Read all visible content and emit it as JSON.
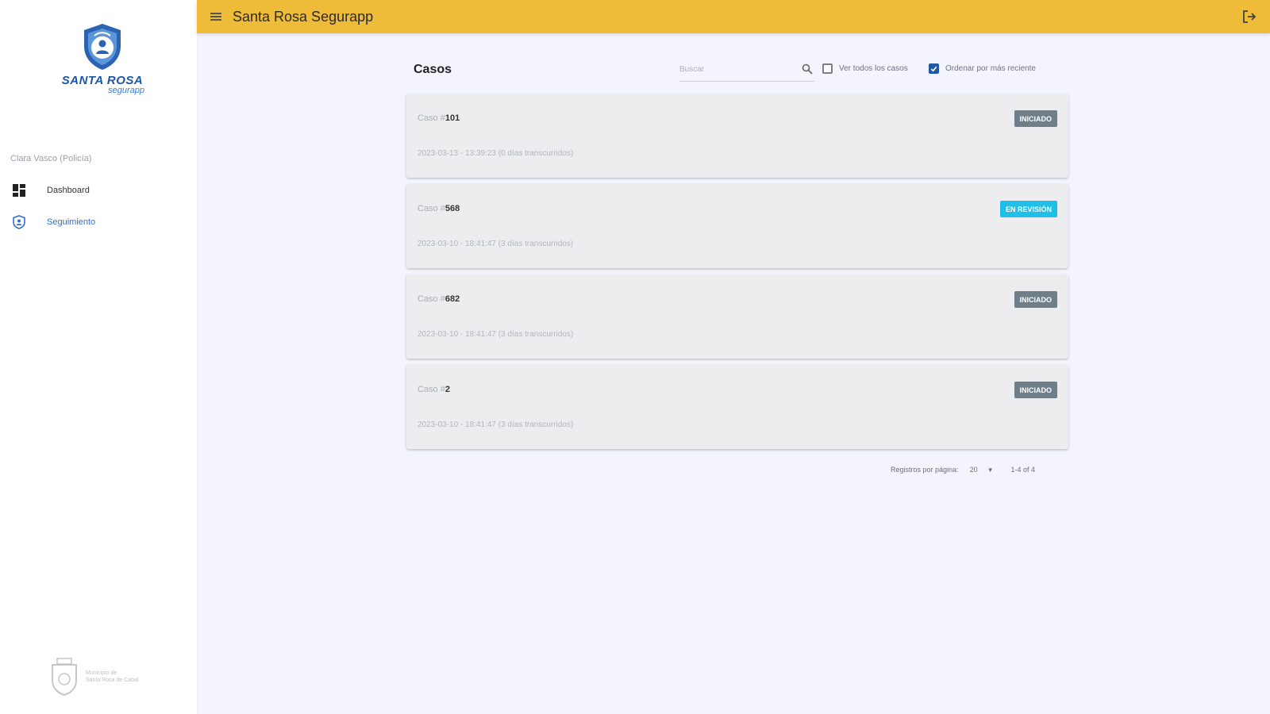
{
  "app": {
    "title": "Santa Rosa Segurapp"
  },
  "logo": {
    "name": "SANTA ROSA",
    "sub": "segurapp"
  },
  "sidebar": {
    "user": "Clara Vasco (Policía)",
    "items": [
      {
        "label": "Dashboard",
        "icon": "dashboard-icon"
      },
      {
        "label": "Seguimiento",
        "icon": "shield-user-icon",
        "active": true
      }
    ],
    "footer": {
      "line1": "Municipio de",
      "line2": "Santa Rosa de Cabal"
    }
  },
  "cases": {
    "title": "Casos",
    "search_placeholder": "Buscar",
    "filter_all_label": "Ver todos los casos",
    "filter_all_checked": false,
    "sort_recent_label": "Ordenar por más reciente",
    "sort_recent_checked": true,
    "case_prefix": "Caso #",
    "items": [
      {
        "number": "101",
        "status": "INICIADO",
        "status_color": "#6e7f8a",
        "date": "2023-03-13 - 13:39:23 (0 días transcurridos)"
      },
      {
        "number": "568",
        "status": "EN REVISIÓN",
        "status_color": "#1ec0e8",
        "date": "2023-03-10 - 18:41:47 (3 días transcurridos)"
      },
      {
        "number": "682",
        "status": "INICIADO",
        "status_color": "#6e7f8a",
        "date": "2023-03-10 - 18:41:47 (3 días transcurridos)"
      },
      {
        "number": "2",
        "status": "INICIADO",
        "status_color": "#6e7f8a",
        "date": "2023-03-10 - 18:41:47 (3 días transcurridos)"
      }
    ]
  },
  "pagination": {
    "rows_label": "Registros por página:",
    "rows_value": "20",
    "range": "1-4 of 4"
  },
  "colors": {
    "topbar": "#efbc39",
    "brand_blue": "#1d56a6"
  }
}
